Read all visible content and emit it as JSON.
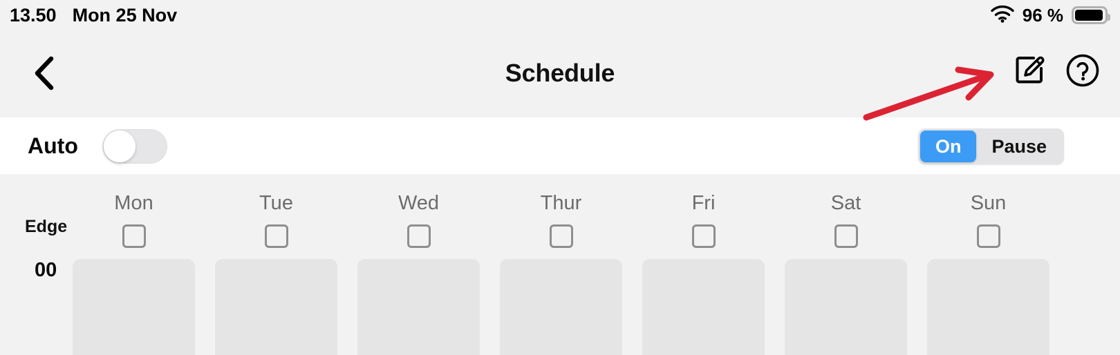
{
  "status_bar": {
    "time": "13.50",
    "date": "Mon 25 Nov",
    "battery_percent": "96 %",
    "wifi_icon": "wifi-icon",
    "battery_icon": "battery-icon"
  },
  "nav_bar": {
    "back_icon": "chevron-left-icon",
    "title": "Schedule",
    "edit_icon": "edit-pencil-square-icon",
    "help_icon": "question-mark-circle-icon"
  },
  "auto_row": {
    "label": "Auto",
    "toggle_state": "off",
    "segmented": {
      "options": [
        "On",
        "Pause"
      ],
      "selected": "On",
      "active_color": "#3c9bf5"
    }
  },
  "schedule": {
    "row_label": "Edge",
    "days": [
      {
        "name": "Mon",
        "checked": false
      },
      {
        "name": "Tue",
        "checked": false
      },
      {
        "name": "Wed",
        "checked": false
      },
      {
        "name": "Thur",
        "checked": false
      },
      {
        "name": "Fri",
        "checked": false
      },
      {
        "name": "Sat",
        "checked": false
      },
      {
        "name": "Sun",
        "checked": false
      }
    ],
    "hours": [
      "00"
    ],
    "cell_color": "#e5e5e5"
  },
  "annotation": {
    "arrow_color": "#dc2334",
    "points_to": "edit-pencil-square-icon"
  }
}
